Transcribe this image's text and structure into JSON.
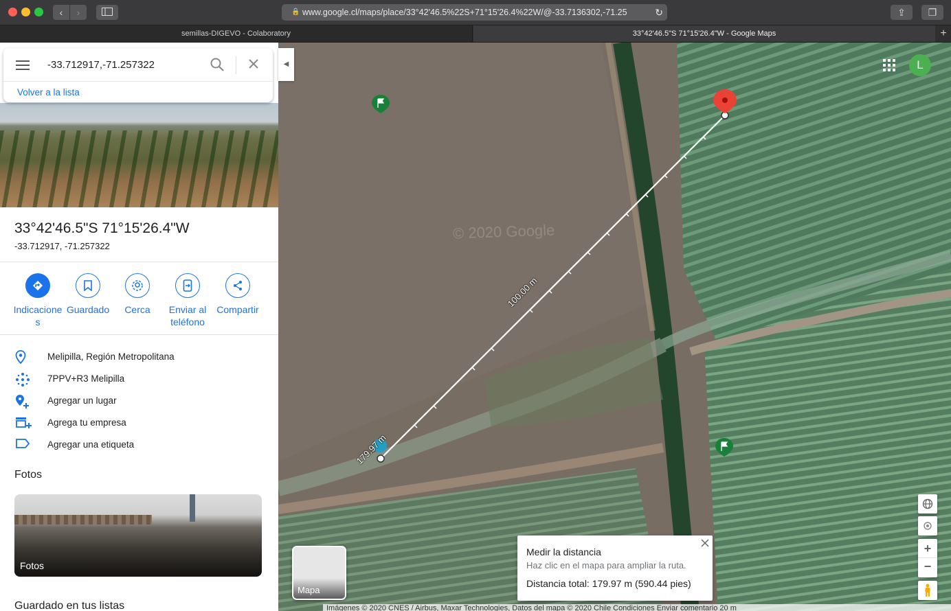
{
  "browser": {
    "url": "www.google.cl/maps/place/33°42'46.5%22S+71°15'26.4%22W/@-33.7136302,-71.25",
    "tabs": [
      {
        "label": "semillas-DIGEVO - Colaboratory"
      },
      {
        "label": "33°42'46.5\"S 71°15'26.4\"W - Google Maps"
      }
    ],
    "new_tab_label": "+"
  },
  "search": {
    "query": "-33.712917,-71.257322",
    "back_link": "Volver a la lista"
  },
  "place": {
    "title": "33°42'46.5\"S 71°15'26.4\"W",
    "coords": "-33.712917, -71.257322"
  },
  "actions": [
    {
      "label": "Indicaciones",
      "icon": "directions-icon"
    },
    {
      "label": "Guardado",
      "icon": "bookmark-icon"
    },
    {
      "label": "Cerca",
      "icon": "nearby-icon"
    },
    {
      "label": "Enviar al teléfono",
      "icon": "send-to-phone-icon"
    },
    {
      "label": "Compartir",
      "icon": "share-icon"
    }
  ],
  "info": [
    {
      "text": "Melipilla, Región Metropolitana",
      "icon": "location-pin-icon"
    },
    {
      "text": "7PPV+R3 Melipilla",
      "icon": "plus-code-icon"
    },
    {
      "text": "Agregar un lugar",
      "icon": "add-place-icon"
    },
    {
      "text": "Agrega tu empresa",
      "icon": "add-business-icon"
    },
    {
      "text": "Agregar una etiqueta",
      "icon": "label-icon"
    }
  ],
  "photos": {
    "heading": "Fotos",
    "tile_label": "Fotos"
  },
  "saved": {
    "heading": "Guardado en tus listas"
  },
  "map": {
    "watermark": "© 2020 Google",
    "line_label": "100.00 m",
    "start_label": "179.97 m",
    "avatar_letter": "L",
    "layer_label": "Mapa",
    "measure": {
      "title": "Medir la distancia",
      "hint": "Haz clic en el mapa para ampliar la ruta.",
      "total": "Distancia total: 179.97 m (590.44 pies)"
    },
    "attribution": "Imágenes © 2020 CNES / Airbus, Maxar Technologies, Datos del mapa © 2020     Chile     Condiciones     Enviar comentario     20 m"
  },
  "colors": {
    "accent": "#1a73e8",
    "pin": "#ea4335",
    "avatar": "#4caf50"
  }
}
